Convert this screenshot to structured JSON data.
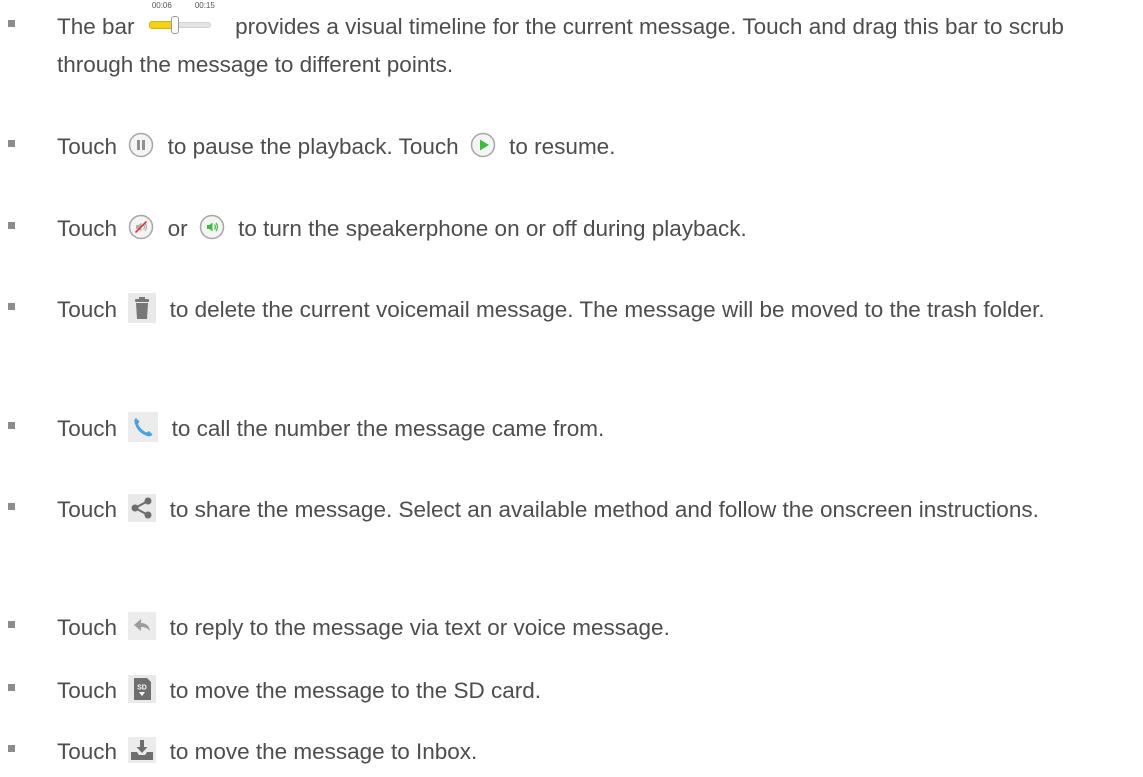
{
  "items": [
    {
      "scrubber": {
        "start_time": "00:06",
        "end_time": "00:15",
        "progress": 0.4
      },
      "before": "The bar",
      "after": "provides a visual timeline for the current message. Touch and drag this bar to scrub through the message to different points."
    },
    {
      "before": "Touch",
      "pause_icon": "pause-icon",
      "middle": "to pause the playback. Touch",
      "play_icon": "play-icon",
      "after": "to resume."
    },
    {
      "before": "Touch",
      "speaker_off_icon": "speaker-off-icon",
      "middle": "or",
      "speaker_on_icon": "speaker-on-icon",
      "after": "to turn the speakerphone on or off during playback."
    },
    {
      "before": "Touch",
      "icon": "trash-icon",
      "after": "to delete the current voicemail message. The message will be moved to the trash folder."
    },
    {
      "before": "Touch",
      "icon": "phone-icon",
      "after": "to call the number the message came from."
    },
    {
      "before": "Touch",
      "icon": "share-icon",
      "after": "to share the message. Select an available method and follow the onscreen instructions."
    },
    {
      "before": "Touch",
      "icon": "reply-icon",
      "after": "to reply to the message via text or voice message."
    },
    {
      "before": "Touch",
      "icon": "sd-card-icon",
      "icon_label": "SD",
      "after": "to move the message to the SD card."
    },
    {
      "before": "Touch",
      "icon": "inbox-icon",
      "after": "to move the message to Inbox."
    }
  ],
  "colors": {
    "text": "#4d4d4d",
    "bullet": "#8c8c8c",
    "play_green": "#3dbd3d",
    "scrub_fill": "#f3d21b",
    "icon_gray": "#9a9a9a"
  }
}
